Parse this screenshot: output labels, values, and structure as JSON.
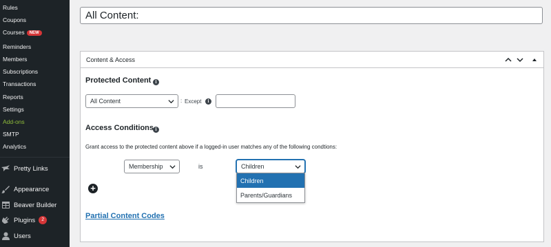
{
  "sidebar": {
    "submenu": [
      {
        "label": "Rules"
      },
      {
        "label": "Coupons"
      },
      {
        "label": "Courses",
        "badge": "NEW"
      },
      {
        "label": "Reminders"
      },
      {
        "label": "Members"
      },
      {
        "label": "Subscriptions"
      },
      {
        "label": "Transactions"
      },
      {
        "label": "Reports"
      },
      {
        "label": "Settings"
      },
      {
        "label": "Add-ons"
      },
      {
        "label": "SMTP"
      },
      {
        "label": "Analytics"
      }
    ],
    "menu": [
      {
        "label": "Pretty Links",
        "icon": "pretty-links-icon"
      },
      {
        "label": "Appearance",
        "icon": "paintbrush-icon"
      },
      {
        "label": "Beaver Builder",
        "icon": "grid-icon"
      },
      {
        "label": "Plugins",
        "icon": "plug-icon",
        "badge": "2"
      },
      {
        "label": "Users",
        "icon": "user-icon"
      }
    ]
  },
  "title": {
    "value": "All Content:"
  },
  "metabox": {
    "title": "Content & Access",
    "protected": {
      "heading": "Protected Content",
      "select_value": "All Content",
      "colon": ":",
      "except_label": "Except",
      "except_value": ""
    },
    "access": {
      "heading": "Access Conditions",
      "description": "Grant access to the protected content above if a logged-in user matches any of the following condtions:",
      "type_select": "Membership",
      "operator": "is",
      "value_select": "Children",
      "options": [
        "Children",
        "Parents/Guardians"
      ]
    },
    "partial_link": "Partial Content Codes"
  },
  "colors": {
    "sidebar_bg": "#1d2327",
    "accent": "#2271b1",
    "badge": "#d63638",
    "addons_green": "#8fbc3a"
  }
}
